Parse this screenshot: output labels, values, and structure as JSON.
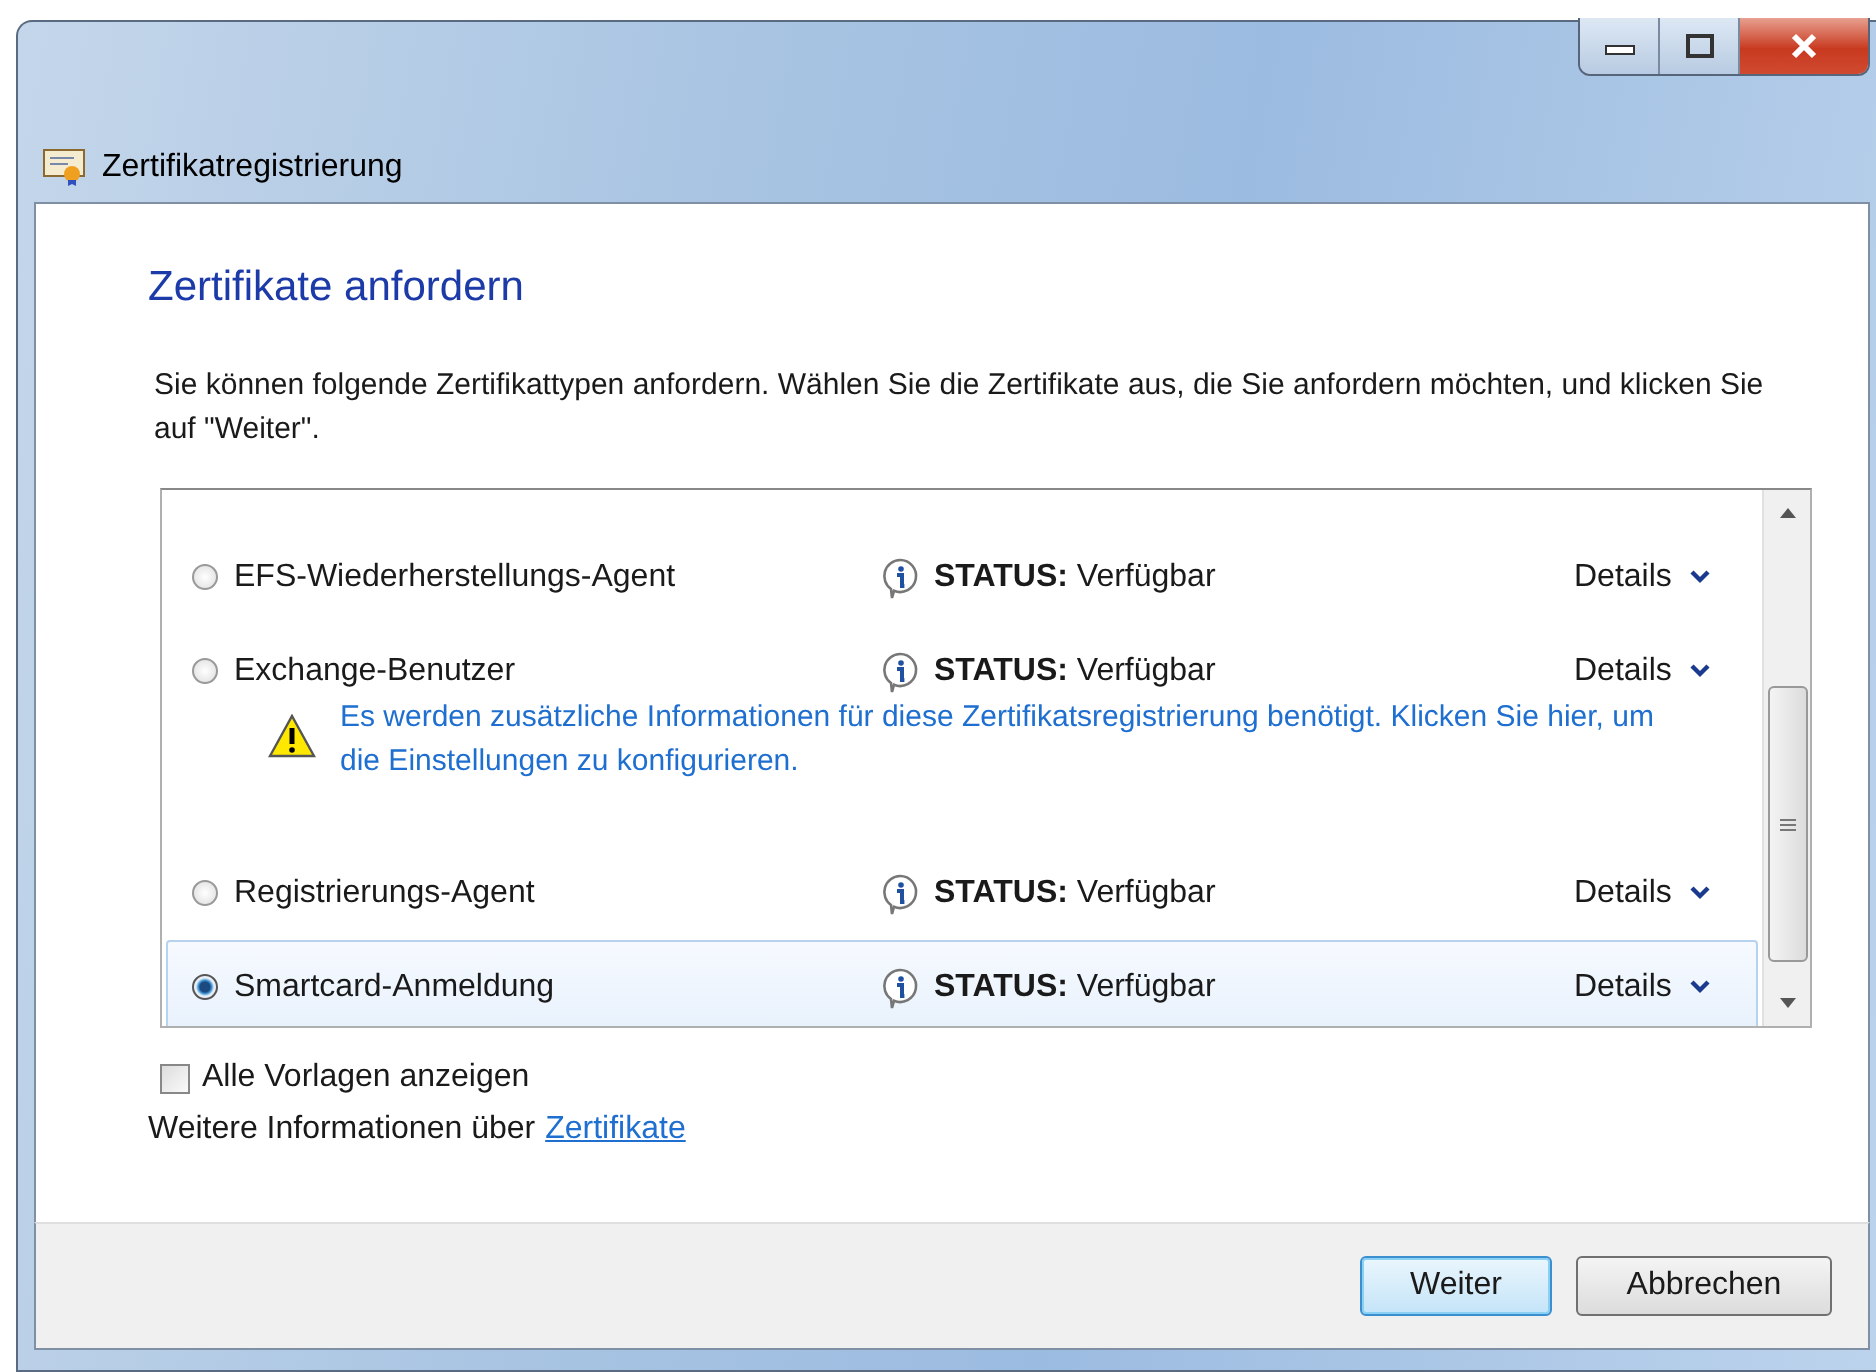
{
  "window": {
    "title": "Zertifikatregistrierung"
  },
  "heading": "Zertifikate anfordern",
  "intro": "Sie können folgende Zertifikattypen anfordern. Wählen Sie die Zertifikate aus, die Sie anfordern möchten, und klicken Sie auf \"Weiter\".",
  "templates": [
    {
      "name": "EFS-Wiederherstellungs-Agent",
      "status": "**STATUS:** Verfügbar",
      "details": "Details",
      "selected": false
    },
    {
      "name": "Exchange-Benutzer",
      "status": "**STATUS:** Verfügbar",
      "details": "Details",
      "selected": false,
      "warning": "Es werden zusätzliche Informationen für diese Zertifikatsregistrierung benötigt. Klicken Sie hier, um die Einstellungen zu konfigurieren."
    },
    {
      "name": "Registrierungs-Agent",
      "status": "**STATUS:** Verfügbar",
      "details": "Details",
      "selected": false
    },
    {
      "name": "Smartcard-Anmeldung",
      "status": "**STATUS:** Verfügbar",
      "details": "Details",
      "selected": true
    }
  ],
  "show_all": {
    "label": "Alle Vorlagen anzeigen",
    "checked": false
  },
  "more_info": {
    "text": "Weitere Informationen über",
    "link": "Zertifikate"
  },
  "buttons": [
    {
      "label": "Weiter",
      "default": true
    },
    {
      "label": "Abbrechen",
      "default": false
    }
  ]
}
